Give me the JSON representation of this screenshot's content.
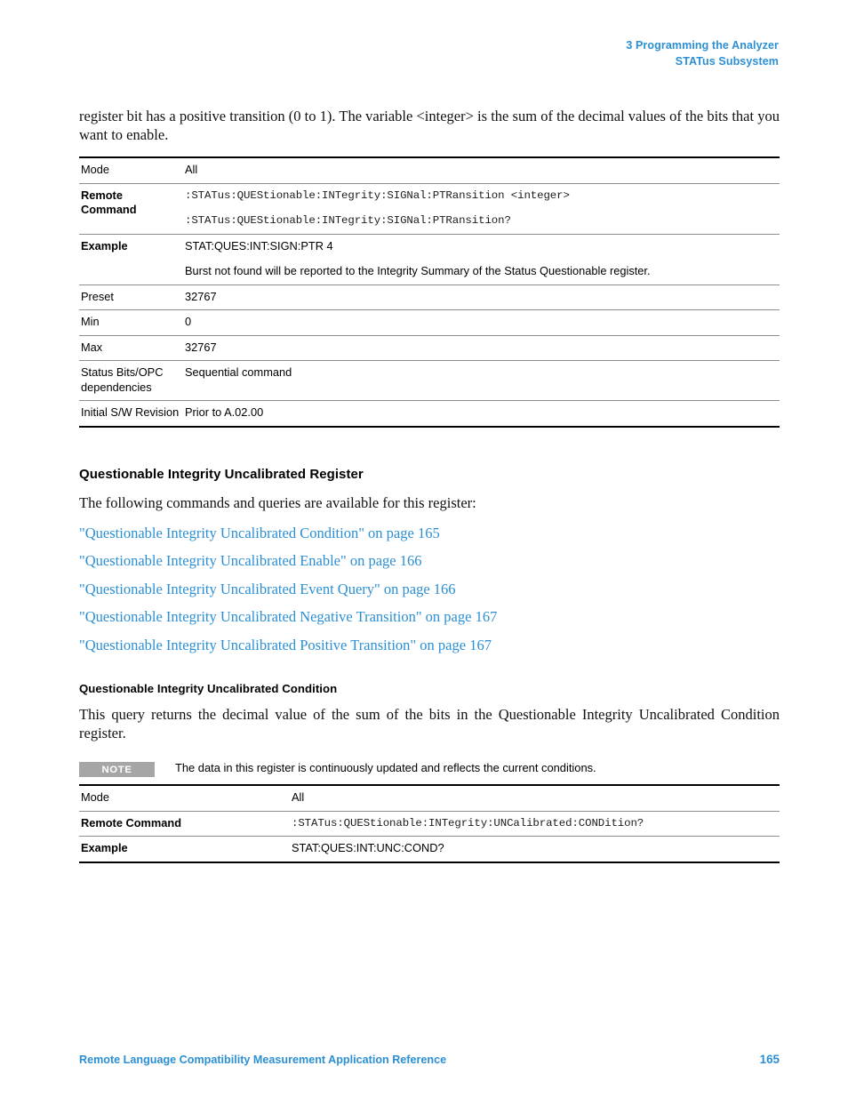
{
  "header": {
    "line1": "3  Programming the Analyzer",
    "line2": "STATus Subsystem",
    "color": "#2b8fd4"
  },
  "intro_paragraph": "register bit has a positive transition (0 to 1). The variable <integer> is the sum of the decimal values of the bits that you want to enable.",
  "table_ptransition": {
    "rows": [
      {
        "label": "Mode",
        "bold": false,
        "values": [
          "All"
        ],
        "mono": false
      },
      {
        "label": "Remote Command",
        "bold": true,
        "values": [
          ":STATus:QUEStionable:INTegrity:SIGNal:PTRansition <integer>",
          ":STATus:QUEStionable:INTegrity:SIGNal:PTRansition?"
        ],
        "mono": true
      },
      {
        "label": "Example",
        "bold": true,
        "values": [
          "STAT:QUES:INT:SIGN:PTR 4",
          "Burst not found will be reported to the Integrity Summary of the Status Questionable register."
        ],
        "mono": false
      },
      {
        "label": "Preset",
        "bold": false,
        "values": [
          "32767"
        ],
        "mono": false
      },
      {
        "label": "Min",
        "bold": false,
        "values": [
          "0"
        ],
        "mono": false
      },
      {
        "label": "Max",
        "bold": false,
        "values": [
          "32767"
        ],
        "mono": false
      },
      {
        "label": "Status Bits/OPC dependencies",
        "bold": false,
        "values": [
          "Sequential command"
        ],
        "mono": false
      },
      {
        "label": "Initial S/W Revision",
        "bold": false,
        "values": [
          "Prior to A.02.00"
        ],
        "mono": false
      }
    ]
  },
  "section": {
    "heading": "Questionable Integrity Uncalibrated Register",
    "intro": "The following commands and queries are available for this register:",
    "links": [
      "\"Questionable Integrity Uncalibrated Condition\" on page 165",
      "\"Questionable Integrity Uncalibrated Enable\" on page 166",
      "\"Questionable Integrity Uncalibrated Event Query\" on page 166",
      "\"Questionable Integrity Uncalibrated Negative Transition\" on page 167",
      "\"Questionable Integrity Uncalibrated Positive Transition\" on page 167"
    ],
    "link_color": "#2b8fd4"
  },
  "subsection": {
    "heading": "Questionable Integrity Uncalibrated Condition",
    "paragraph": "This query returns the decimal value of the sum of the bits in the Questionable Integrity Uncalibrated Condition register."
  },
  "note": {
    "badge": "NOTE",
    "badge_color": "#a6a6a6",
    "text": "The data in this register is continuously updated and reflects the current conditions."
  },
  "table_uncal_condition": {
    "rows": [
      {
        "label": "Mode",
        "bold": false,
        "values": [
          "All"
        ],
        "mono": false
      },
      {
        "label": "Remote Command",
        "bold": true,
        "values": [
          ":STATus:QUEStionable:INTegrity:UNCalibrated:CONDition?"
        ],
        "mono": true
      },
      {
        "label": "Example",
        "bold": true,
        "values": [
          "STAT:QUES:INT:UNC:COND?"
        ],
        "mono": false
      }
    ]
  },
  "footer": {
    "title": "Remote Language Compatibility Measurement Application Reference",
    "page": "165"
  }
}
